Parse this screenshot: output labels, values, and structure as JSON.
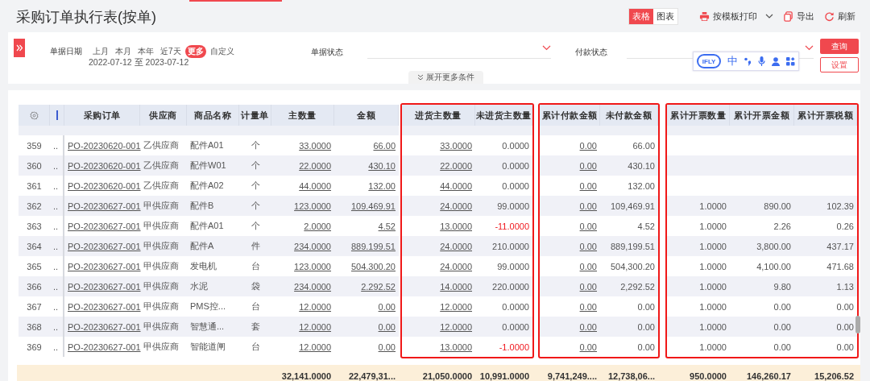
{
  "title": "采购订单执行表(按单)",
  "view_toggle": [
    {
      "label": "表格",
      "selected": true
    },
    {
      "label": "图表",
      "selected": false
    }
  ],
  "toolbar": [
    {
      "label": "按模板打印",
      "kind": "print",
      "dropdown": true
    },
    {
      "label": "导出",
      "kind": "export",
      "dropdown": false
    },
    {
      "label": "刷新",
      "kind": "refresh",
      "dropdown": false
    }
  ],
  "filters": {
    "date": {
      "label": "单据日期",
      "presets": [
        {
          "label": "上月",
          "selected": false
        },
        {
          "label": "本月",
          "selected": false
        },
        {
          "label": "本年",
          "selected": false
        },
        {
          "label": "近7天",
          "selected": false
        },
        {
          "label": "更多",
          "selected": true
        },
        {
          "label": "自定义",
          "selected": false
        }
      ],
      "range": "2022-07-12 至 2023-07-12"
    },
    "status": {
      "label": "单据状态"
    },
    "payment_status": {
      "label": "付款状态"
    },
    "more_conditions": "展开更多条件"
  },
  "buttons": {
    "query": "查询",
    "settings": "设置"
  },
  "ime_toolbar": {
    "logo": "IFLY",
    "mode": "中"
  },
  "table": {
    "groups": [
      {
        "highlighted": false,
        "columns": [
          {
            "kind": "settings"
          },
          {
            "kind": "cut"
          },
          {
            "label": "采购订单",
            "link": true
          },
          {
            "label": "供应商",
            "link": false
          },
          {
            "label": "商品名称",
            "link": false
          },
          {
            "label": "计量单",
            "link": false
          },
          {
            "label": "主数量",
            "link": true,
            "total": "32,141.0000"
          },
          {
            "label": "金额",
            "link": true,
            "total": "22,479,31..."
          }
        ]
      },
      {
        "highlighted": true,
        "columns": [
          {
            "label": "进货主数量",
            "link": true,
            "total": "21,050.0000"
          },
          {
            "label": "未进货主数量",
            "link": false,
            "total": "10,991.0000"
          }
        ]
      },
      {
        "highlighted": true,
        "columns": [
          {
            "label": "累计付款金额",
            "link": true,
            "total": "9,741,249...."
          },
          {
            "label": "未付款金额",
            "link": false,
            "total": "12,738,06..."
          }
        ]
      },
      {
        "highlighted": true,
        "columns": [
          {
            "label": "累计开票数量",
            "link": false,
            "total": "950.0000"
          },
          {
            "label": "累计开票金额",
            "link": false,
            "total": "146,260.17"
          },
          {
            "label": "累计开票税额",
            "link": false,
            "total": "15,206.52"
          }
        ]
      }
    ],
    "rows": [
      {
        "cells": [
          "359",
          "..",
          "PO-20230620-001",
          "乙供应商",
          "配件A01",
          "个",
          "33.0000",
          "66.00",
          "33.0000",
          "0.0000",
          "0.00",
          "66.00",
          null,
          null,
          null
        ]
      },
      {
        "cells": [
          "360",
          "..",
          "PO-20230620-001",
          "乙供应商",
          "配件W01",
          "个",
          "22.0000",
          "430.10",
          "22.0000",
          "0.0000",
          "0.00",
          "430.10",
          null,
          null,
          null
        ]
      },
      {
        "cells": [
          "361",
          "..",
          "PO-20230620-001",
          "乙供应商",
          "配件A02",
          "个",
          "44.0000",
          "132.00",
          "44.0000",
          "0.0000",
          "0.00",
          "132.00",
          null,
          null,
          null
        ]
      },
      {
        "cells": [
          "362",
          "..",
          "PO-20230627-001",
          "甲供应商",
          "配件B",
          "个",
          "123.0000",
          "109.469.91",
          "24.0000",
          "99.0000",
          "0.00",
          "109,469.91",
          "1.0000",
          "890.00",
          "102.39"
        ]
      },
      {
        "cells": [
          "363",
          "..",
          "PO-20230627-001",
          "甲供应商",
          "配件A01",
          "个",
          "2.0000",
          "4.52",
          "13.0000",
          {
            "text": "-11.0000",
            "negative": true
          },
          "0.00",
          "4.52",
          "1.0000",
          "2.26",
          "0.26"
        ]
      },
      {
        "cells": [
          "364",
          "..",
          "PO-20230627-001",
          "甲供应商",
          "配件A",
          "件",
          "234.0000",
          "889.199.51",
          "24.0000",
          "210.0000",
          "0.00",
          "889,199.51",
          "1.0000",
          "3,800.00",
          "437.17"
        ]
      },
      {
        "cells": [
          "365",
          "..",
          "PO-20230627-001",
          "甲供应商",
          "发电机",
          "台",
          "123.0000",
          "504.300.20",
          "24.0000",
          "99.0000",
          "0.00",
          "504,300.20",
          "1.0000",
          "4,100.00",
          "471.68"
        ]
      },
      {
        "cells": [
          "366",
          "..",
          "PO-20230627-001",
          "甲供应商",
          "水泥",
          "袋",
          "234.0000",
          "2.292.52",
          "14.0000",
          "220.0000",
          "0.00",
          "2,292.52",
          "1.0000",
          "9.80",
          "1.13"
        ]
      },
      {
        "cells": [
          "367",
          "..",
          "PO-20230627-001",
          "甲供应商",
          "PMS控...",
          "台",
          "12.0000",
          "0.00",
          "12.0000",
          "0.0000",
          "0.00",
          "0.00",
          "1.0000",
          "0.00",
          "0.00"
        ]
      },
      {
        "cells": [
          "368",
          "..",
          "PO-20230627-001",
          "甲供应商",
          "智慧通...",
          "套",
          "12.0000",
          "0.00",
          "12.0000",
          "0.0000",
          "0.00",
          "0.00",
          "1.0000",
          "0.00",
          "0.00"
        ]
      },
      {
        "cells": [
          "369",
          "..",
          "PO-20230627-001",
          "甲供应商",
          "智能道闸",
          "台",
          "12.0000",
          "0.00",
          "13.0000",
          {
            "text": "-1.0000",
            "negative": true
          },
          "0.00",
          "0.00",
          "1.0000",
          "0.00",
          "0.00"
        ]
      }
    ]
  }
}
